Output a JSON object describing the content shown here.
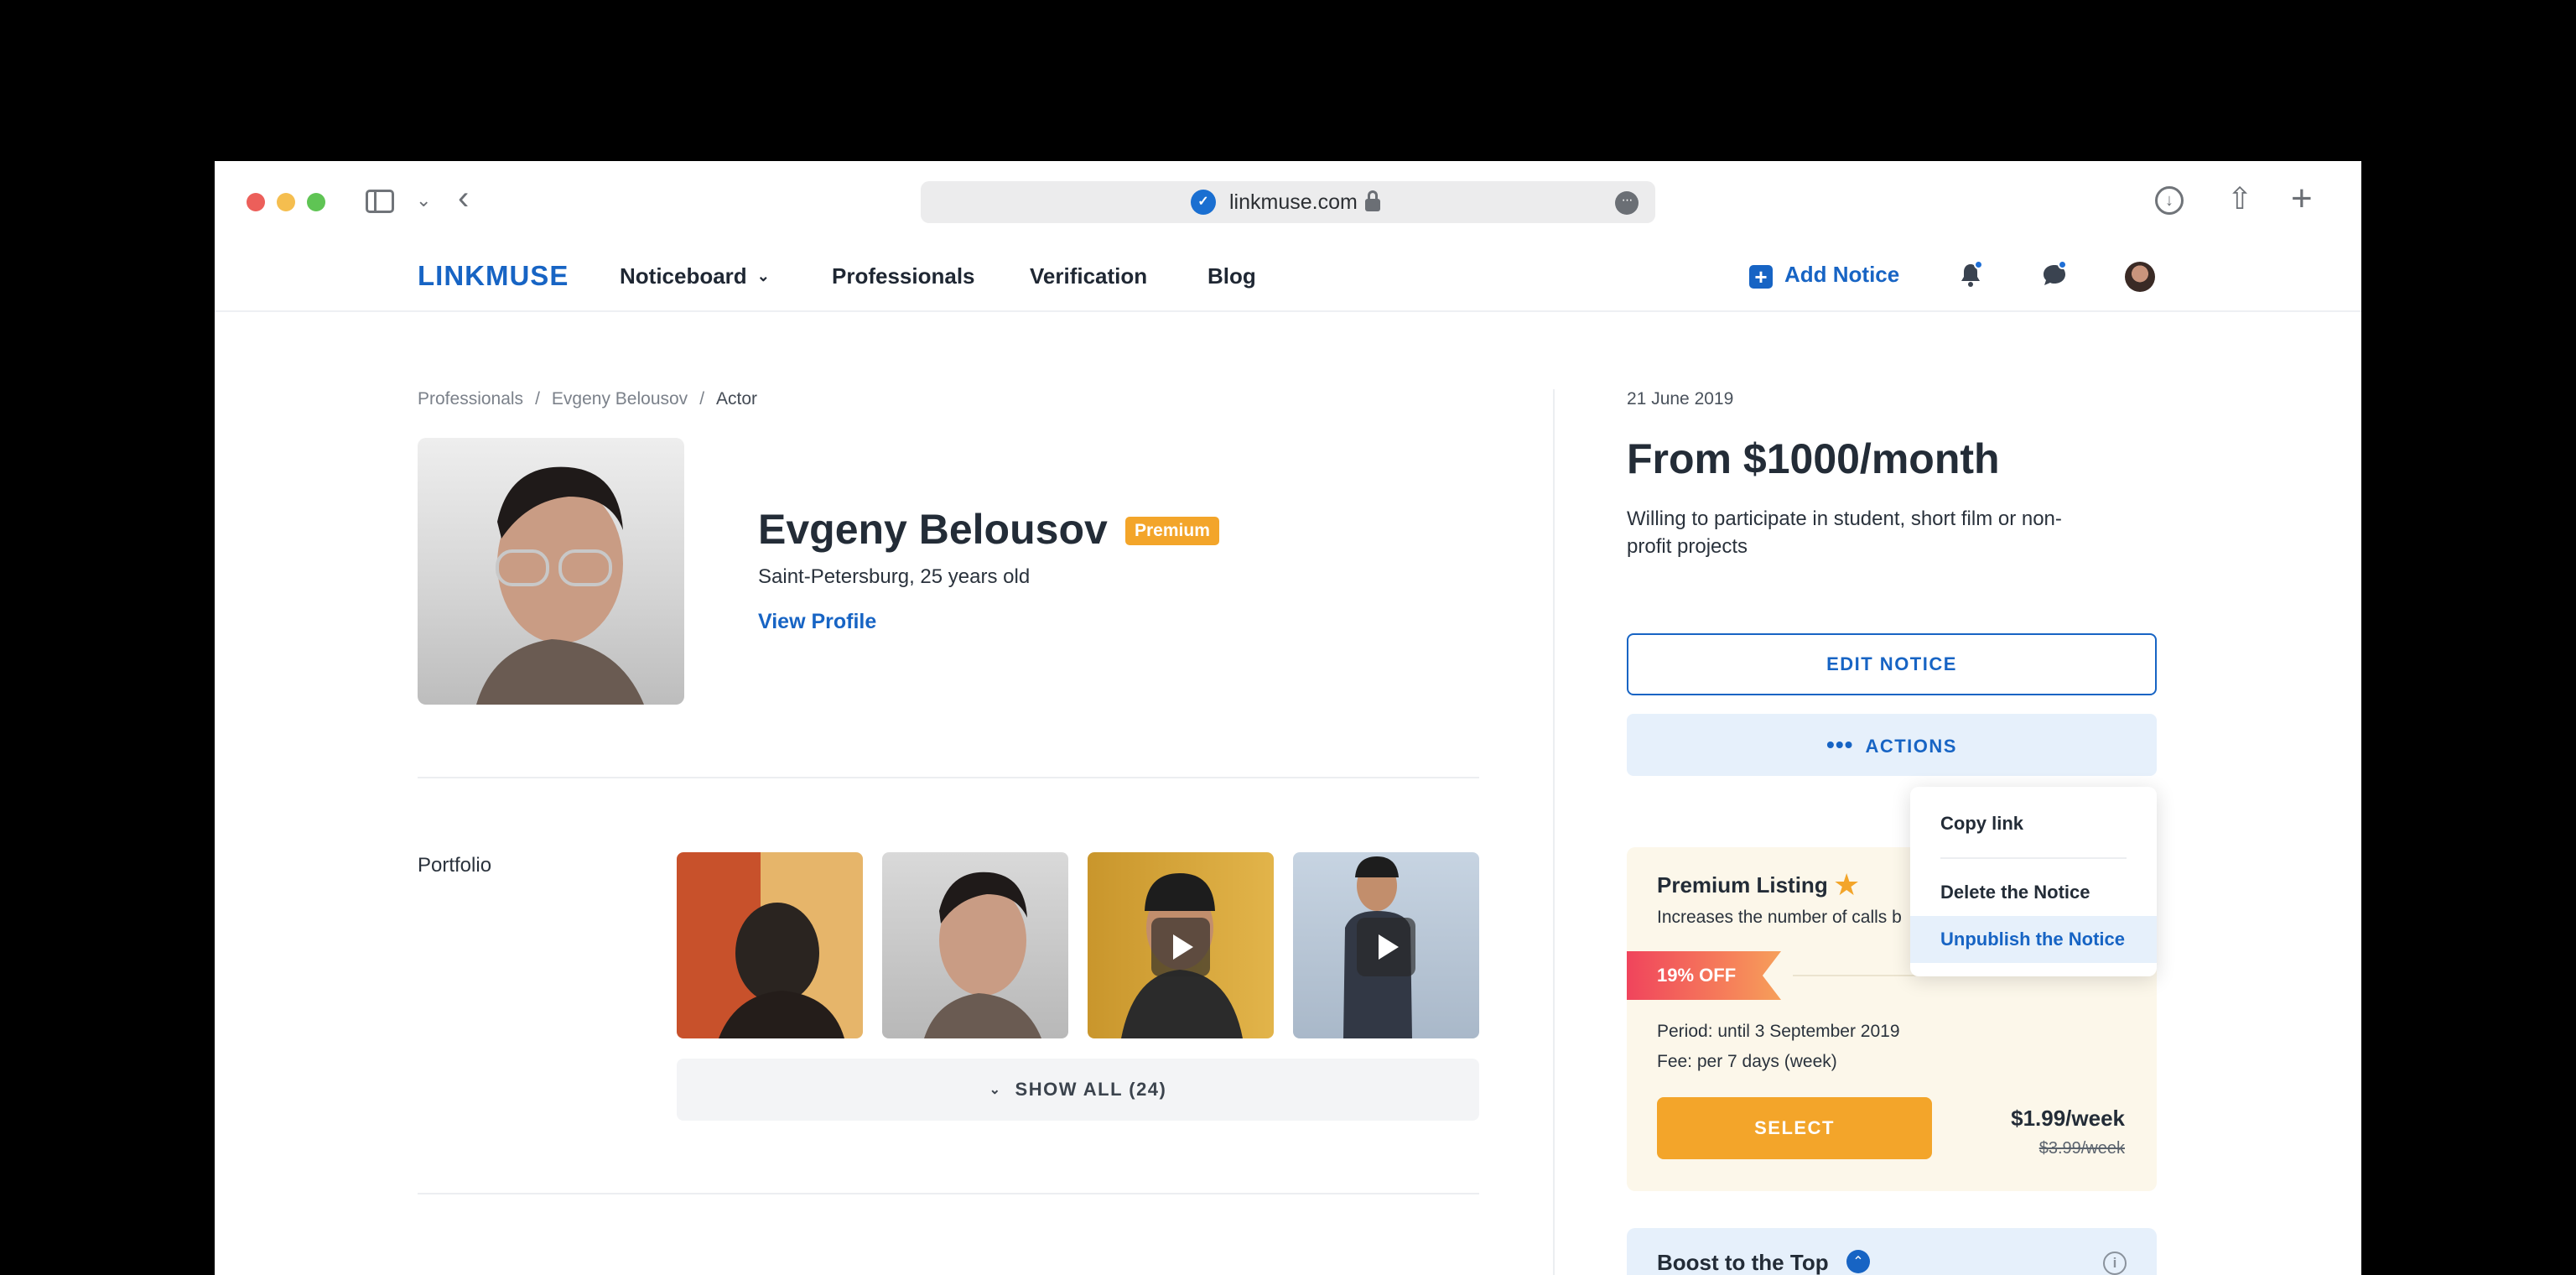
{
  "browser": {
    "url": "linkmuse.com"
  },
  "nav": {
    "logo": "LINKMUSE",
    "items": [
      "Noticeboard",
      "Professionals",
      "Verification",
      "Blog"
    ],
    "add_notice": "Add Notice"
  },
  "breadcrumb": [
    "Professionals",
    "Evgeny Belousov",
    "Actor"
  ],
  "breadcrumb_sep": "/",
  "profile": {
    "name": "Evgeny Belousov",
    "badge": "Premium",
    "location": "Saint-Petersburg, 25 years old",
    "view_profile": "View Profile"
  },
  "portfolio": {
    "label": "Portfolio",
    "show_all": "SHOW ALL (24)"
  },
  "notice": {
    "date": "21 June 2019",
    "price": "From $1000/month",
    "description": "Willing to participate in student, short film or non-profit projects",
    "edit_button": "EDIT NOTICE",
    "actions_button": "ACTIONS",
    "actions_dots": "•••"
  },
  "actions_menu": {
    "copy_link": "Copy link",
    "delete": "Delete the Notice",
    "unpublish": "Unpublish the Notice"
  },
  "premium_listing": {
    "title": "Premium Listing",
    "subtitle": "Increases the number of calls b",
    "discount": "19% OFF",
    "period": "Period: until 3 September 2019",
    "fee": "Fee: per 7 days (week)",
    "select_button": "SELECT",
    "new_price": "$1.99/week",
    "old_price": "$3.99/week"
  },
  "boost": {
    "title": "Boost to the Top"
  },
  "colors": {
    "accent": "#1764c4",
    "premium": "#f3a52a",
    "discount_start": "#f0445c"
  }
}
